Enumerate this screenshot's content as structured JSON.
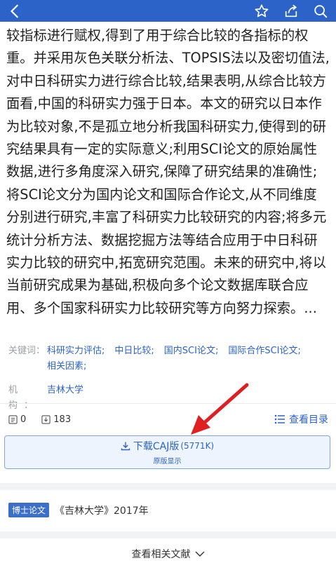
{
  "abstract": {
    "text": "较指标进行赋权,得到了用于综合比较的各指标的权重。并采用灰色关联分析法、TOPSIS法以及密切值法,对中日科研实力进行综合比较,结果表明,从综合比较方面看,中国的科研实力强于日本。本文的研究以日本作为比较对象,不是孤立地分析我国科研实力,使得到的研究结果具有一定的实际意义;利用SCI论文的原始属性数据,进行多角度深入研究,保障了研究结果的准确性;将SCI论文分为国内论文和国际合作论文,从不同维度分别进行研究,丰富了科研实力比较研究的内容;将多元统计分析方法、数据挖掘方法等结合应用于中日科研实力比较的研究中,拓宽研究范围。未来的研究中,将以当前研究成果为基础,积极向多个论文数据库联合应用、多个国家科研实力比较研究等方向努力探索。..."
  },
  "meta": {
    "keywords_label": "关键词：",
    "keywords": [
      "科研实力评估;",
      "中日比较;",
      "国内SCI论文;",
      "国际合作SCI论文;",
      "相关因素;"
    ],
    "institution_label": "机构：",
    "institution": "吉林大学"
  },
  "stats": {
    "citations": "0",
    "downloads": "183",
    "catalog_label": "查看目录"
  },
  "download": {
    "label": "下载CAJ版",
    "size": "(5771K)",
    "sub": "原版显示"
  },
  "source": {
    "badge": "博士论文",
    "text": "《吉林大学》2017年"
  },
  "related": {
    "label": "查看相关文献"
  },
  "colors": {
    "topbar": "#2b63c9",
    "accent": "#2b63c9",
    "annotation_arrow": "#e02020"
  }
}
